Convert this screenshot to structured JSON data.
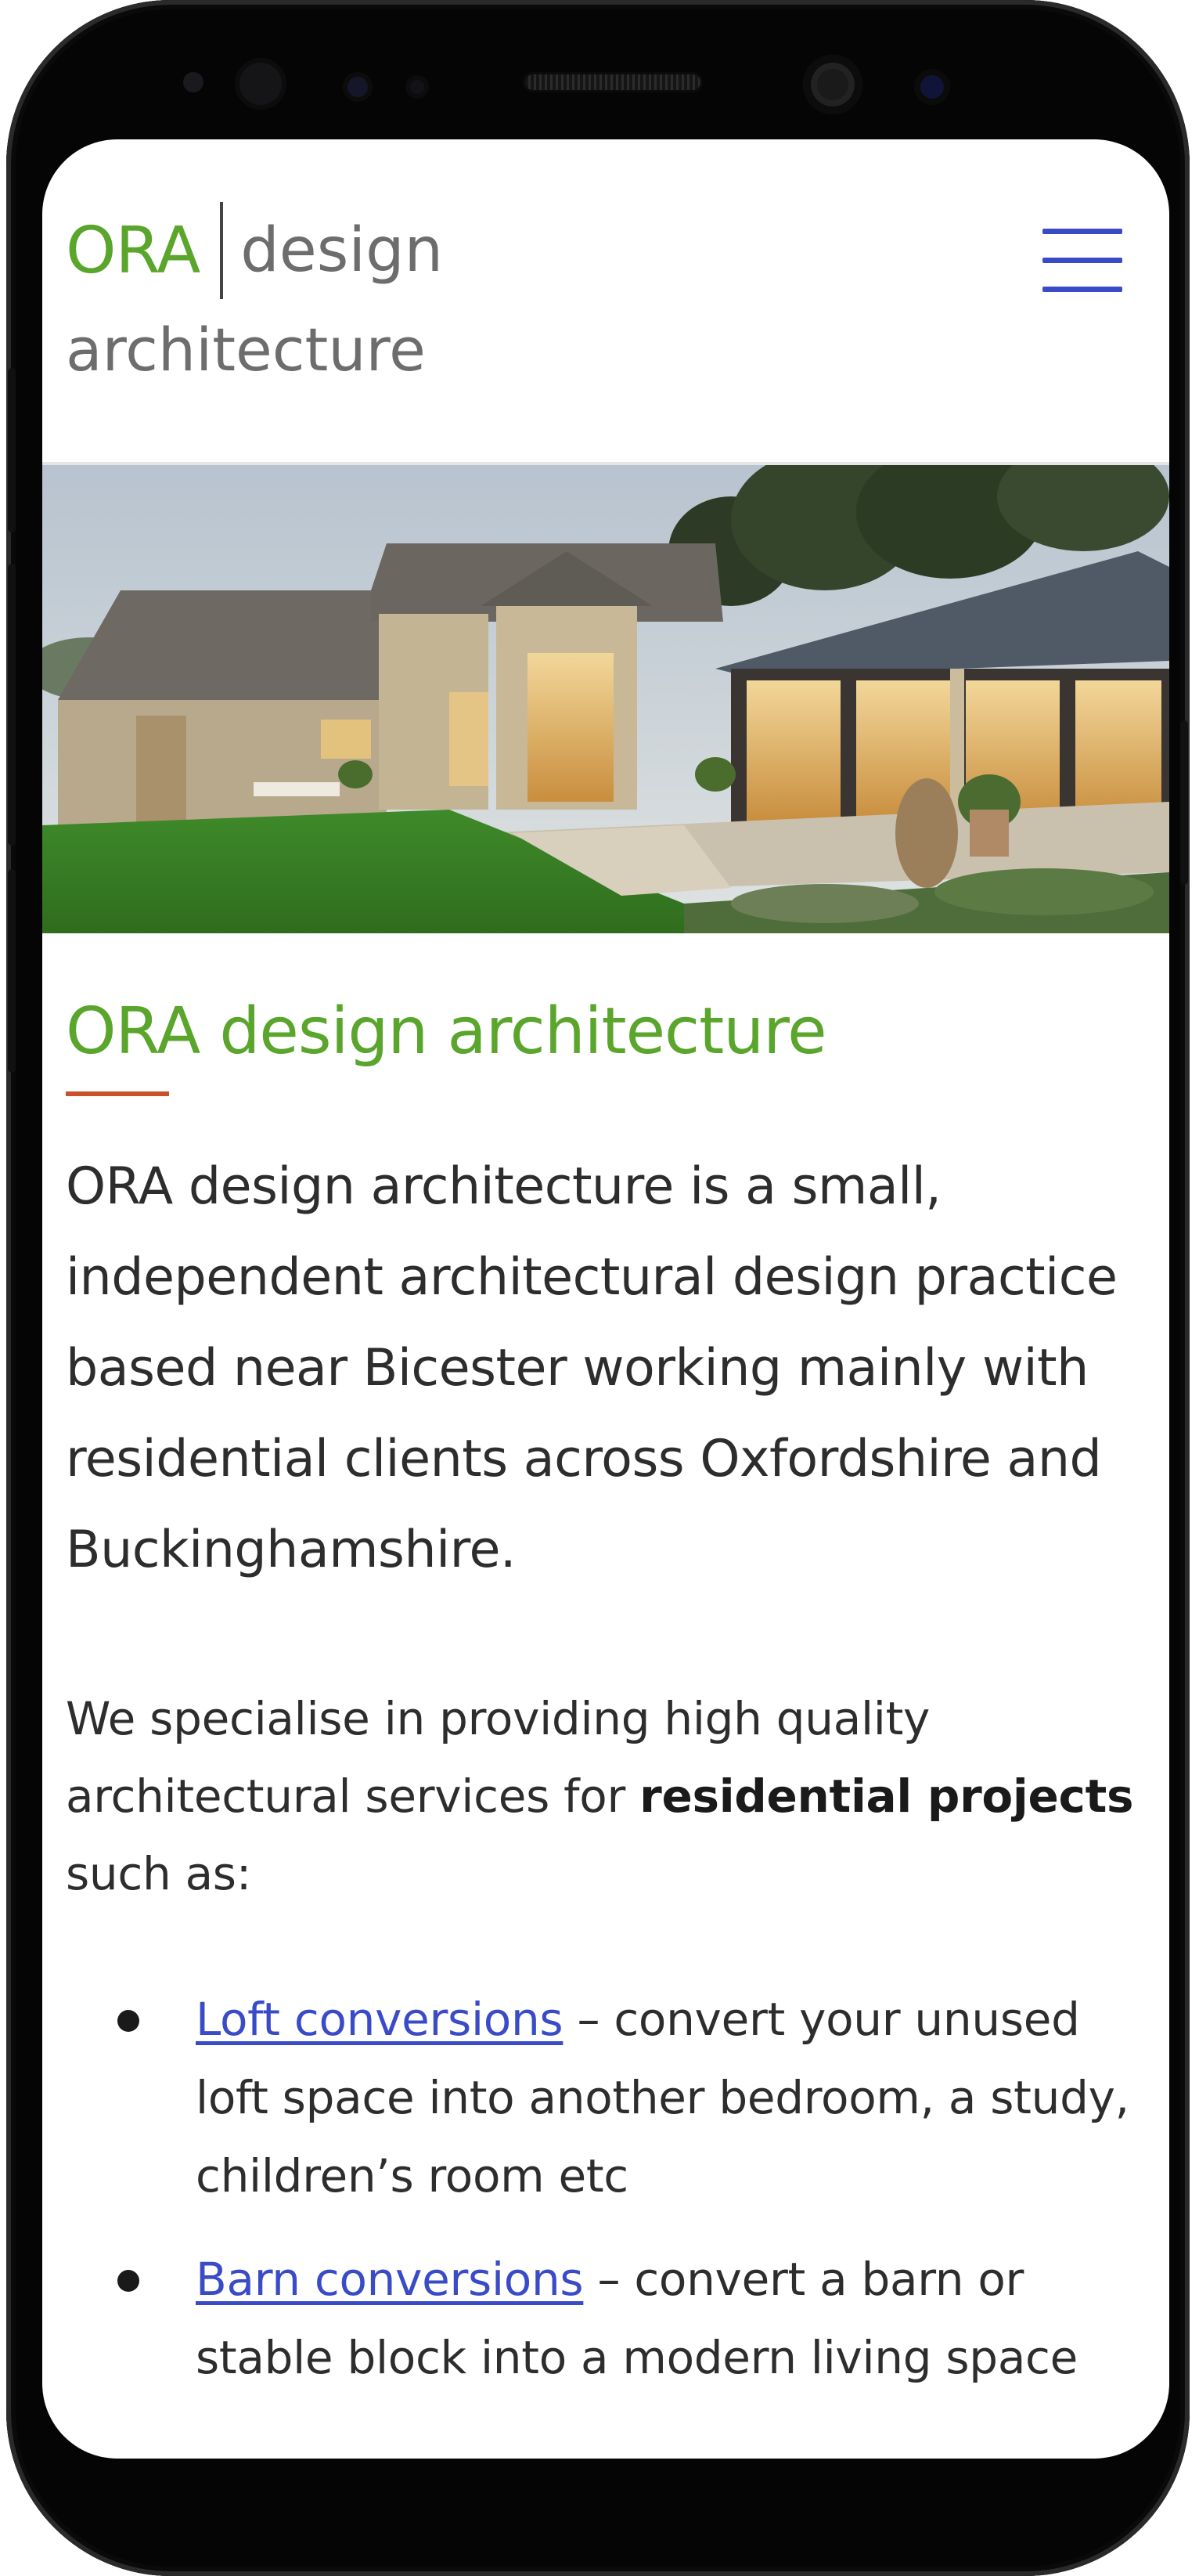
{
  "logo": {
    "ora": "ORA",
    "design": "design",
    "architecture": "architecture"
  },
  "menu_icon": "hamburger-menu-icon",
  "hero": {
    "subject": "stone-barn-conversion-photo"
  },
  "main": {
    "title": "ORA design architecture",
    "lead": "ORA design architecture is a small, independent architectural design practice based near Bicester working mainly with residential clients across Oxfordshire and Buckinghamshire.",
    "intro_text": "We specialise in providing high quality architectural services for ",
    "intro_bold": "residential projects",
    "intro_end": " such as:",
    "services": [
      {
        "link": "Loft conversions",
        "text": " – convert your unused loft space into another bedroom, a study, children’s room etc"
      },
      {
        "link": "Barn conversions",
        "text": " – convert a barn or stable block into a modern living space"
      }
    ]
  },
  "colors": {
    "brand_green": "#5aa52b",
    "logo_grey": "#6d6d6d",
    "link_blue": "#3a4bc8",
    "accent_rule": "#c9502a",
    "body_text": "#2d2d2d"
  }
}
